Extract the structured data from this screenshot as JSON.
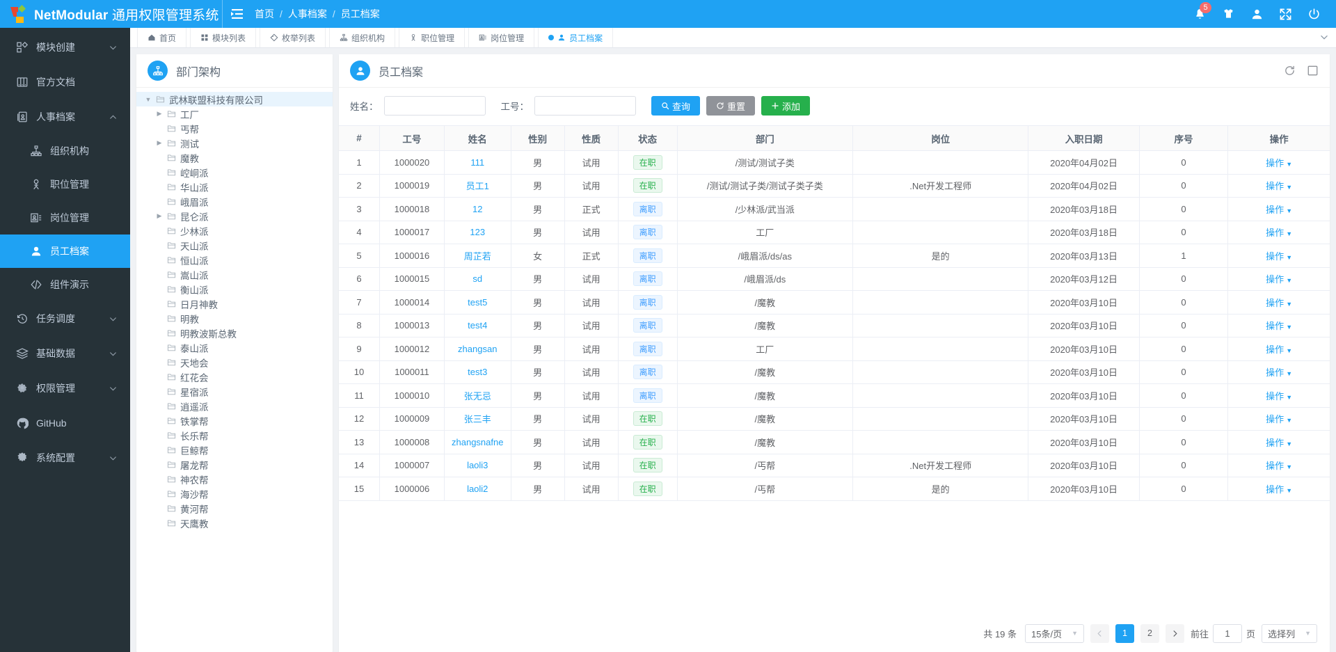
{
  "header": {
    "brand_net": "NetModular",
    "brand_rest": " 通用权限管理系统",
    "breadcrumb": [
      "首页",
      "人事档案",
      "员工档案"
    ],
    "separator": "/",
    "notification_count": "5",
    "icons": [
      "bell-icon",
      "theme-shirt-icon",
      "user-icon",
      "fullscreen-icon",
      "power-icon"
    ],
    "accent_color": "#1fa2f3"
  },
  "sidebar": {
    "items": [
      {
        "label": "模块创建",
        "icon": "module-create-icon",
        "expandable": true,
        "active": false,
        "sub": false
      },
      {
        "label": "官方文档",
        "icon": "document-icon",
        "expandable": false,
        "active": false,
        "sub": false
      },
      {
        "label": "人事档案",
        "icon": "hr-archive-icon",
        "expandable": true,
        "expanded": true,
        "active": false,
        "sub": false
      },
      {
        "label": "组织机构",
        "icon": "org-structure-icon",
        "expandable": false,
        "active": false,
        "sub": true
      },
      {
        "label": "职位管理",
        "icon": "position-icon",
        "expandable": false,
        "active": false,
        "sub": true
      },
      {
        "label": "岗位管理",
        "icon": "job-icon",
        "expandable": false,
        "active": false,
        "sub": true
      },
      {
        "label": "员工档案",
        "icon": "employee-icon",
        "expandable": false,
        "active": true,
        "sub": true
      },
      {
        "label": "组件演示",
        "icon": "code-icon",
        "expandable": false,
        "active": false,
        "sub": true
      },
      {
        "label": "任务调度",
        "icon": "schedule-clock-icon",
        "expandable": true,
        "active": false,
        "sub": false
      },
      {
        "label": "基础数据",
        "icon": "layers-icon",
        "expandable": true,
        "active": false,
        "sub": false
      },
      {
        "label": "权限管理",
        "icon": "permission-gear-icon",
        "expandable": true,
        "active": false,
        "sub": false
      },
      {
        "label": "GitHub",
        "icon": "github-icon",
        "expandable": false,
        "active": false,
        "sub": false
      },
      {
        "label": "系统配置",
        "icon": "settings-gear-icon",
        "expandable": true,
        "active": false,
        "sub": false
      }
    ]
  },
  "tabbar": {
    "tabs": [
      {
        "label": "首页",
        "icon": "home-icon",
        "active": false
      },
      {
        "label": "模块列表",
        "icon": "grid-icon",
        "active": false
      },
      {
        "label": "枚举列表",
        "icon": "tag-icon",
        "active": false
      },
      {
        "label": "组织机构",
        "icon": "org-structure-icon",
        "active": false
      },
      {
        "label": "职位管理",
        "icon": "position-icon",
        "active": false
      },
      {
        "label": "岗位管理",
        "icon": "job-icon",
        "active": false
      },
      {
        "label": "员工档案",
        "icon": "employee-icon",
        "active": true
      }
    ],
    "more_icon": "chevron-down-icon"
  },
  "tree_panel": {
    "title": "部门架构",
    "icon": "org-tree-icon",
    "actions": [
      "refresh-icon",
      "expand-icon"
    ],
    "nodes": [
      {
        "label": "武林联盟科技有限公司",
        "depth": 0,
        "expandable": true,
        "expanded": true,
        "selected": true
      },
      {
        "label": "工厂",
        "depth": 1,
        "expandable": true,
        "expanded": false,
        "selected": false
      },
      {
        "label": "丐帮",
        "depth": 1,
        "expandable": false,
        "selected": false
      },
      {
        "label": "测试",
        "depth": 1,
        "expandable": true,
        "expanded": false,
        "selected": false
      },
      {
        "label": "魔教",
        "depth": 1,
        "expandable": false,
        "selected": false
      },
      {
        "label": "崆峒派",
        "depth": 1,
        "expandable": false,
        "selected": false
      },
      {
        "label": "华山派",
        "depth": 1,
        "expandable": false,
        "selected": false
      },
      {
        "label": "峨眉派",
        "depth": 1,
        "expandable": false,
        "selected": false
      },
      {
        "label": "昆仑派",
        "depth": 1,
        "expandable": true,
        "expanded": false,
        "selected": false
      },
      {
        "label": "少林派",
        "depth": 1,
        "expandable": false,
        "selected": false
      },
      {
        "label": "天山派",
        "depth": 1,
        "expandable": false,
        "selected": false
      },
      {
        "label": "恒山派",
        "depth": 1,
        "expandable": false,
        "selected": false
      },
      {
        "label": "嵩山派",
        "depth": 1,
        "expandable": false,
        "selected": false
      },
      {
        "label": "衡山派",
        "depth": 1,
        "expandable": false,
        "selected": false
      },
      {
        "label": "日月神教",
        "depth": 1,
        "expandable": false,
        "selected": false
      },
      {
        "label": "明教",
        "depth": 1,
        "expandable": false,
        "selected": false
      },
      {
        "label": "明教波斯总教",
        "depth": 1,
        "expandable": false,
        "selected": false
      },
      {
        "label": "泰山派",
        "depth": 1,
        "expandable": false,
        "selected": false
      },
      {
        "label": "天地会",
        "depth": 1,
        "expandable": false,
        "selected": false
      },
      {
        "label": "红花会",
        "depth": 1,
        "expandable": false,
        "selected": false
      },
      {
        "label": "星宿派",
        "depth": 1,
        "expandable": false,
        "selected": false
      },
      {
        "label": "逍遥派",
        "depth": 1,
        "expandable": false,
        "selected": false
      },
      {
        "label": "铁掌帮",
        "depth": 1,
        "expandable": false,
        "selected": false
      },
      {
        "label": "长乐帮",
        "depth": 1,
        "expandable": false,
        "selected": false
      },
      {
        "label": "巨鲸帮",
        "depth": 1,
        "expandable": false,
        "selected": false
      },
      {
        "label": "屠龙帮",
        "depth": 1,
        "expandable": false,
        "selected": false
      },
      {
        "label": "神农帮",
        "depth": 1,
        "expandable": false,
        "selected": false
      },
      {
        "label": "海沙帮",
        "depth": 1,
        "expandable": false,
        "selected": false
      },
      {
        "label": "黄河帮",
        "depth": 1,
        "expandable": false,
        "selected": false
      },
      {
        "label": "天鹰教",
        "depth": 1,
        "expandable": false,
        "selected": false
      }
    ]
  },
  "table_panel": {
    "title": "员工档案",
    "icon": "employee-icon",
    "actions": [
      "refresh-icon",
      "fullscreen-panel-icon"
    ],
    "search": {
      "name_label": "姓名：",
      "name_value": "",
      "name_placeholder": "",
      "code_label": "工号：",
      "code_value": "",
      "code_placeholder": "",
      "query_button": "查询",
      "query_icon": "search-icon",
      "reset_button": "重置",
      "reset_icon": "refresh-icon",
      "add_button": "添加",
      "add_icon": "plus-icon"
    },
    "columns": [
      "#",
      "工号",
      "姓名",
      "性别",
      "性质",
      "状态",
      "部门",
      "岗位",
      "入职日期",
      "序号",
      "操作"
    ],
    "operation_label": "操作",
    "operation_caret": "chevron-down-icon",
    "rows": [
      {
        "no": "1",
        "code": "1000020",
        "name": "111",
        "gender": "男",
        "nature": "试用",
        "status": "在职",
        "status_type": "green",
        "dept": "/测试/测试子类",
        "job": "",
        "date": "2020年04月02日",
        "seq": "0"
      },
      {
        "no": "2",
        "code": "1000019",
        "name": "员工1",
        "gender": "男",
        "nature": "试用",
        "status": "在职",
        "status_type": "green",
        "dept": "/测试/测试子类/测试子类子类",
        "job": ".Net开发工程师",
        "date": "2020年04月02日",
        "seq": "0"
      },
      {
        "no": "3",
        "code": "1000018",
        "name": "12",
        "gender": "男",
        "nature": "正式",
        "status": "离职",
        "status_type": "blue",
        "dept": "/少林派/武当派",
        "job": "",
        "date": "2020年03月18日",
        "seq": "0"
      },
      {
        "no": "4",
        "code": "1000017",
        "name": "123",
        "gender": "男",
        "nature": "试用",
        "status": "离职",
        "status_type": "blue",
        "dept": "工厂",
        "job": "",
        "date": "2020年03月18日",
        "seq": "0"
      },
      {
        "no": "5",
        "code": "1000016",
        "name": "周芷若",
        "gender": "女",
        "nature": "正式",
        "status": "离职",
        "status_type": "blue",
        "dept": "/峨眉派/ds/as",
        "job": "是的",
        "date": "2020年03月13日",
        "seq": "1"
      },
      {
        "no": "6",
        "code": "1000015",
        "name": "sd",
        "gender": "男",
        "nature": "试用",
        "status": "离职",
        "status_type": "blue",
        "dept": "/峨眉派/ds",
        "job": "",
        "date": "2020年03月12日",
        "seq": "0"
      },
      {
        "no": "7",
        "code": "1000014",
        "name": "test5",
        "gender": "男",
        "nature": "试用",
        "status": "离职",
        "status_type": "blue",
        "dept": "/魔教",
        "job": "",
        "date": "2020年03月10日",
        "seq": "0"
      },
      {
        "no": "8",
        "code": "1000013",
        "name": "test4",
        "gender": "男",
        "nature": "试用",
        "status": "离职",
        "status_type": "blue",
        "dept": "/魔教",
        "job": "",
        "date": "2020年03月10日",
        "seq": "0"
      },
      {
        "no": "9",
        "code": "1000012",
        "name": "zhangsan",
        "gender": "男",
        "nature": "试用",
        "status": "离职",
        "status_type": "blue",
        "dept": "工厂",
        "job": "",
        "date": "2020年03月10日",
        "seq": "0"
      },
      {
        "no": "10",
        "code": "1000011",
        "name": "test3",
        "gender": "男",
        "nature": "试用",
        "status": "离职",
        "status_type": "blue",
        "dept": "/魔教",
        "job": "",
        "date": "2020年03月10日",
        "seq": "0"
      },
      {
        "no": "11",
        "code": "1000010",
        "name": "张无忌",
        "gender": "男",
        "nature": "试用",
        "status": "离职",
        "status_type": "blue",
        "dept": "/魔教",
        "job": "",
        "date": "2020年03月10日",
        "seq": "0"
      },
      {
        "no": "12",
        "code": "1000009",
        "name": "张三丰",
        "gender": "男",
        "nature": "试用",
        "status": "在职",
        "status_type": "green",
        "dept": "/魔教",
        "job": "",
        "date": "2020年03月10日",
        "seq": "0"
      },
      {
        "no": "13",
        "code": "1000008",
        "name": "zhangsnafne",
        "gender": "男",
        "nature": "试用",
        "status": "在职",
        "status_type": "green",
        "dept": "/魔教",
        "job": "",
        "date": "2020年03月10日",
        "seq": "0"
      },
      {
        "no": "14",
        "code": "1000007",
        "name": "laoli3",
        "gender": "男",
        "nature": "试用",
        "status": "在职",
        "status_type": "green",
        "dept": "/丐帮",
        "job": ".Net开发工程师",
        "date": "2020年03月10日",
        "seq": "0"
      },
      {
        "no": "15",
        "code": "1000006",
        "name": "laoli2",
        "gender": "男",
        "nature": "试用",
        "status": "在职",
        "status_type": "green",
        "dept": "/丐帮",
        "job": "是的",
        "date": "2020年03月10日",
        "seq": "0"
      }
    ],
    "pagination": {
      "total_text": "共 19 条",
      "page_size_text": "15条/页",
      "prev_icon": "chevron-left-icon",
      "next_icon": "chevron-right-icon",
      "pages": [
        "1",
        "2"
      ],
      "current_page": "1",
      "jump_prefix": "前往",
      "jump_value": "1",
      "jump_suffix": "页",
      "column_select_text": "选择列"
    }
  }
}
